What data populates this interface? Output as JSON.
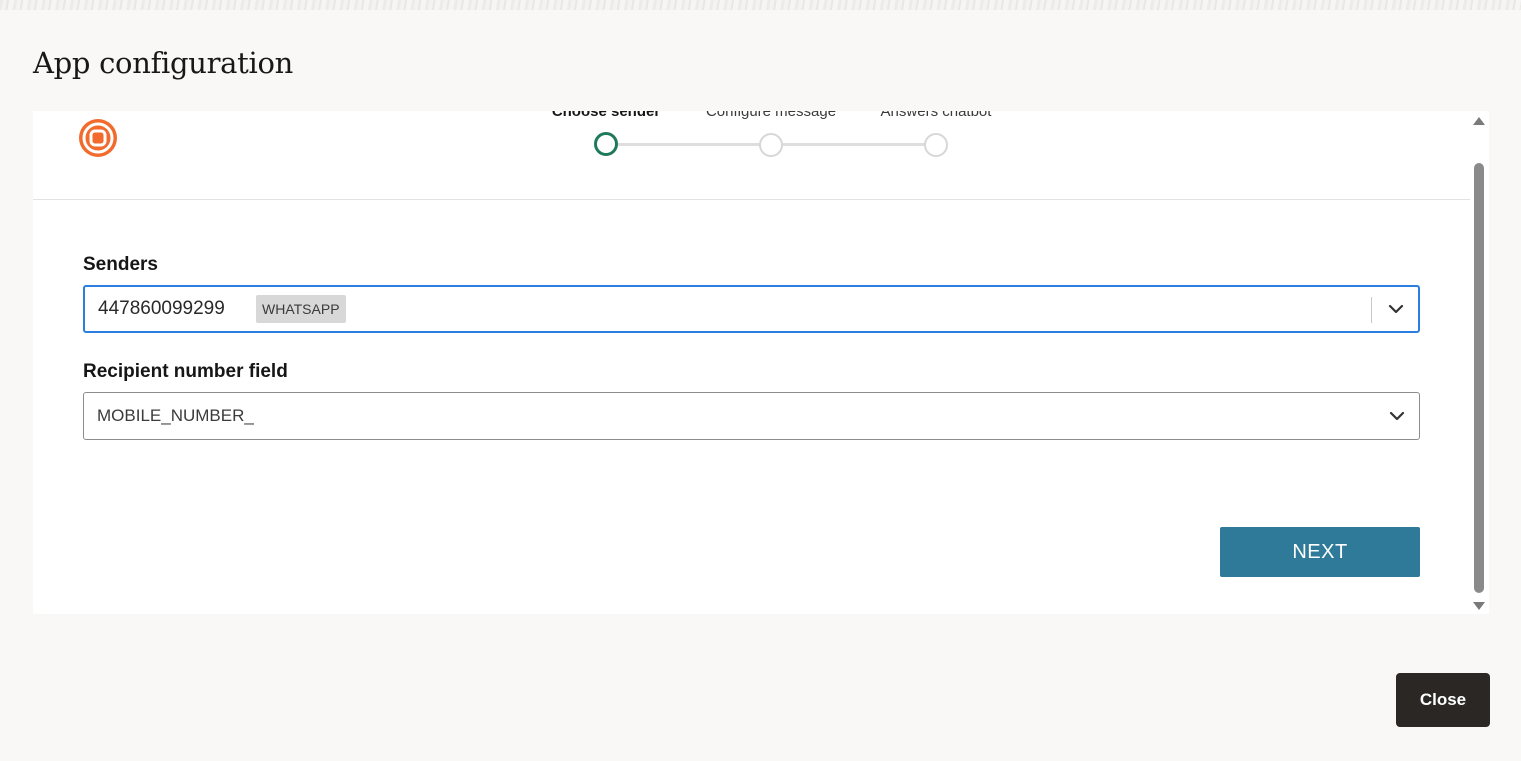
{
  "page": {
    "title": "App configuration"
  },
  "stepper": {
    "steps": [
      {
        "label": "Choose sender",
        "state": "active"
      },
      {
        "label": "Configure message",
        "state": "pending"
      },
      {
        "label": "Answers chatbot",
        "state": "pending"
      }
    ]
  },
  "form": {
    "senders": {
      "label": "Senders",
      "value": "447860099299",
      "badge": "WHATSAPP"
    },
    "recipient": {
      "label": "Recipient number field",
      "value": "MOBILE_NUMBER_"
    },
    "next_label": "NEXT"
  },
  "footer": {
    "close_label": "Close"
  },
  "colors": {
    "logo": "#f26b2c",
    "step_active": "#1f7a5c",
    "next_button": "#2e7a98",
    "focus_border": "#2c7ee0",
    "close_button": "#2b2724"
  },
  "icons": {
    "logo": "app-logo-icon",
    "dropdown": "chevron-down-icon",
    "scroll_up": "scroll-up-arrow-icon",
    "scroll_down": "scroll-down-arrow-icon"
  }
}
